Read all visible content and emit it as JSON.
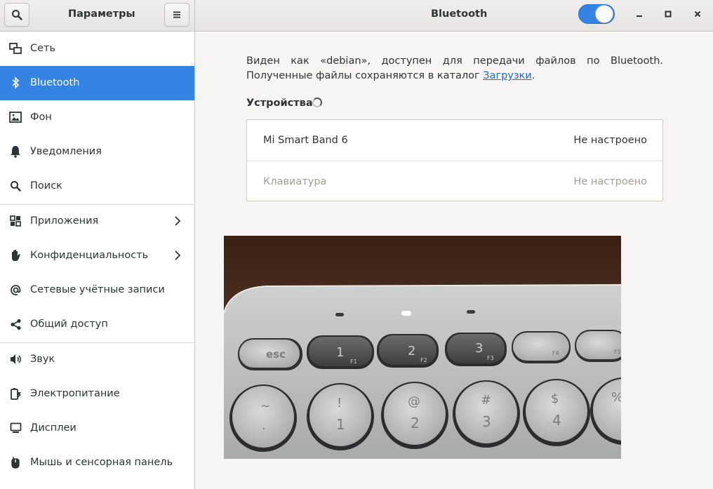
{
  "header": {
    "left_title": "Параметры",
    "right_title": "Bluetooth",
    "bluetooth_toggle_on": true
  },
  "sidebar": {
    "items": [
      {
        "label": "Сеть",
        "icon": "network-icon"
      },
      {
        "label": "Bluetooth",
        "icon": "bluetooth-icon",
        "active": true
      },
      {
        "label": "Фон",
        "icon": "background-icon"
      },
      {
        "label": "Уведомления",
        "icon": "bell-icon"
      },
      {
        "label": "Поиск",
        "icon": "search-icon"
      },
      {
        "label": "Приложения",
        "icon": "apps-grid-icon",
        "chevron": true
      },
      {
        "label": "Конфиденциальность",
        "icon": "hand-icon",
        "chevron": true
      },
      {
        "label": "Сетевые учётные записи",
        "icon": "at-sign-icon"
      },
      {
        "label": "Общий доступ",
        "icon": "share-icon"
      },
      {
        "label": "Звук",
        "icon": "speaker-icon"
      },
      {
        "label": "Электропитание",
        "icon": "power-icon"
      },
      {
        "label": "Дисплеи",
        "icon": "display-icon"
      },
      {
        "label": "Мышь и сенсорная панель",
        "icon": "mouse-icon"
      }
    ]
  },
  "main": {
    "description_pre": "Виден как «debian», доступен для передачи файлов по Bluetooth. Полученные файлы сохраняются в каталог ",
    "description_link": "Загрузки",
    "description_post": ".",
    "devices_heading": "Устройства",
    "devices": [
      {
        "name": "Mi Smart Band 6",
        "status": "Не настроено"
      },
      {
        "name": "Клавиатура",
        "status": "Не настроено"
      }
    ]
  },
  "photo": {
    "keys_row1": [
      "esc",
      "1",
      "2",
      "3",
      "",
      ""
    ],
    "keys_row1_fn": [
      "",
      "F1",
      "F2",
      "F3",
      "F4",
      "F5"
    ],
    "keys_row2_top": [
      "~",
      "!",
      "@",
      "#",
      "$",
      "%"
    ],
    "keys_row2_bottom": [
      ".",
      "1",
      "2",
      "3",
      "4",
      ""
    ]
  },
  "colors": {
    "accent": "#3584e4",
    "link": "#1b6acb"
  }
}
